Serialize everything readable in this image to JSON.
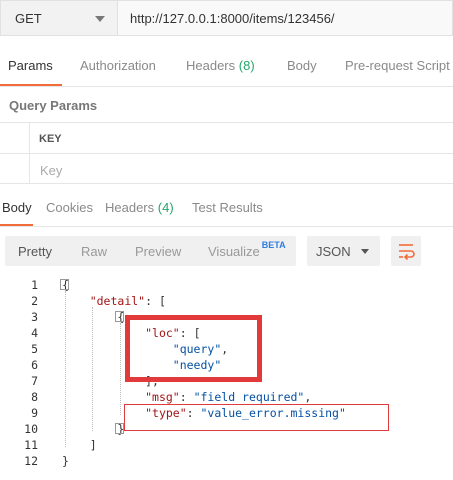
{
  "request": {
    "method": "GET",
    "url": "http://127.0.0.1:8000/items/123456/"
  },
  "request_tabs": [
    {
      "label": "Params",
      "count": ""
    },
    {
      "label": "Authorization",
      "count": ""
    },
    {
      "label": "Headers",
      "count": "(8)"
    },
    {
      "label": "Body",
      "count": ""
    },
    {
      "label": "Pre-request Script",
      "count": ""
    }
  ],
  "query_params": {
    "title": "Query Params",
    "key_header": "KEY",
    "key_placeholder": "Key"
  },
  "response_tabs": [
    {
      "label": "Body",
      "count": ""
    },
    {
      "label": "Cookies",
      "count": ""
    },
    {
      "label": "Headers",
      "count": "(4)"
    },
    {
      "label": "Test Results",
      "count": ""
    }
  ],
  "toolbar": {
    "views": [
      "Pretty",
      "Raw",
      "Preview",
      "Visualize"
    ],
    "beta": "BETA",
    "format": "JSON"
  },
  "code_lines": [
    {
      "n": "1",
      "tokens": [
        {
          "t": "p",
          "v": "{"
        }
      ]
    },
    {
      "n": "2",
      "tokens": [
        {
          "t": "p",
          "v": "    "
        },
        {
          "t": "k",
          "v": "\"detail\""
        },
        {
          "t": "p",
          "v": ": ["
        }
      ]
    },
    {
      "n": "3",
      "tokens": [
        {
          "t": "p",
          "v": "        {"
        }
      ]
    },
    {
      "n": "4",
      "tokens": [
        {
          "t": "p",
          "v": "            "
        },
        {
          "t": "k",
          "v": "\"loc\""
        },
        {
          "t": "p",
          "v": ": ["
        }
      ]
    },
    {
      "n": "5",
      "tokens": [
        {
          "t": "p",
          "v": "                "
        },
        {
          "t": "s",
          "v": "\"query\""
        },
        {
          "t": "p",
          "v": ","
        }
      ]
    },
    {
      "n": "6",
      "tokens": [
        {
          "t": "p",
          "v": "                "
        },
        {
          "t": "s",
          "v": "\"needy\""
        }
      ]
    },
    {
      "n": "7",
      "tokens": [
        {
          "t": "p",
          "v": "            ],"
        }
      ]
    },
    {
      "n": "8",
      "tokens": [
        {
          "t": "p",
          "v": "            "
        },
        {
          "t": "k",
          "v": "\"msg\""
        },
        {
          "t": "p",
          "v": ": "
        },
        {
          "t": "s",
          "v": "\"field required\""
        },
        {
          "t": "p",
          "v": ","
        }
      ]
    },
    {
      "n": "9",
      "tokens": [
        {
          "t": "p",
          "v": "            "
        },
        {
          "t": "k",
          "v": "\"type\""
        },
        {
          "t": "p",
          "v": ": "
        },
        {
          "t": "s",
          "v": "\"value_error.missing\""
        }
      ]
    },
    {
      "n": "10",
      "tokens": [
        {
          "t": "p",
          "v": "        }"
        }
      ]
    },
    {
      "n": "11",
      "tokens": [
        {
          "t": "p",
          "v": "    ]"
        }
      ]
    },
    {
      "n": "12",
      "tokens": [
        {
          "t": "p",
          "v": "}"
        }
      ]
    }
  ],
  "colors": {
    "accent": "#f26b3a",
    "count": "#26a66c",
    "json_key": "#a31515",
    "json_string": "#0451a5",
    "annotation": "#e23a3a"
  },
  "icons": [
    "caret-down-icon",
    "wrap-lines-icon",
    "fold-icon"
  ]
}
